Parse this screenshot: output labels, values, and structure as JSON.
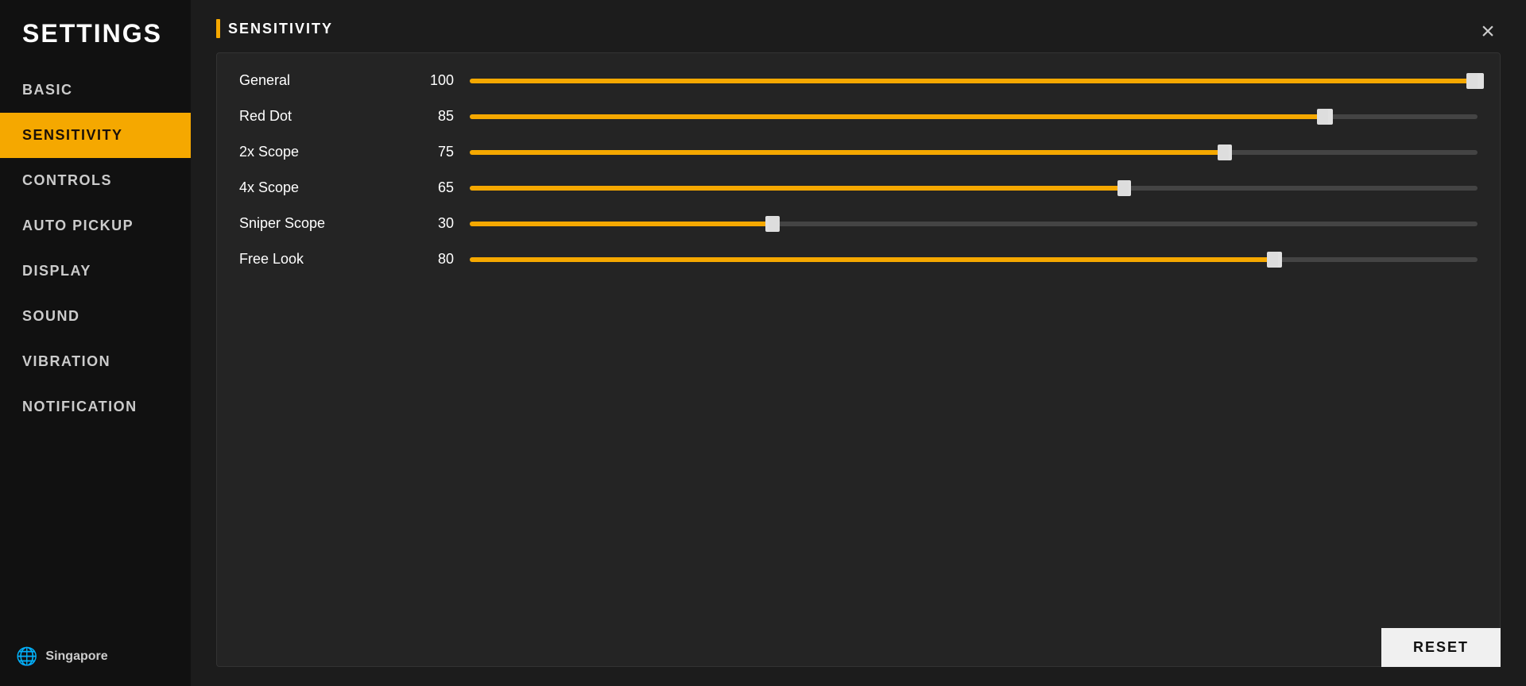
{
  "sidebar": {
    "title": "SETTINGS",
    "items": [
      {
        "id": "basic",
        "label": "BASIC",
        "active": false
      },
      {
        "id": "sensitivity",
        "label": "SENSITIVITY",
        "active": true
      },
      {
        "id": "controls",
        "label": "CONTROLS",
        "active": false
      },
      {
        "id": "auto-pickup",
        "label": "AUTO PICKUP",
        "active": false
      },
      {
        "id": "display",
        "label": "DISPLAY",
        "active": false
      },
      {
        "id": "sound",
        "label": "SOUND",
        "active": false
      },
      {
        "id": "vibration",
        "label": "VIBRATION",
        "active": false
      },
      {
        "id": "notification",
        "label": "NOTIFICATION",
        "active": false
      }
    ],
    "region": "Singapore",
    "globe_icon": "🌐"
  },
  "main": {
    "section_title": "SENSITIVITY",
    "sliders": [
      {
        "label": "General",
        "value": 100,
        "min": 0,
        "max": 100
      },
      {
        "label": "Red Dot",
        "value": 85,
        "min": 0,
        "max": 100
      },
      {
        "label": "2x Scope",
        "value": 75,
        "min": 0,
        "max": 100
      },
      {
        "label": "4x Scope",
        "value": 65,
        "min": 0,
        "max": 100
      },
      {
        "label": "Sniper Scope",
        "value": 30,
        "min": 0,
        "max": 100
      },
      {
        "label": "Free Look",
        "value": 80,
        "min": 0,
        "max": 100
      }
    ],
    "reset_label": "RESET"
  },
  "close_label": "×",
  "colors": {
    "accent": "#f5a800",
    "active_bg": "#f5a800",
    "active_text": "#1a1008"
  }
}
